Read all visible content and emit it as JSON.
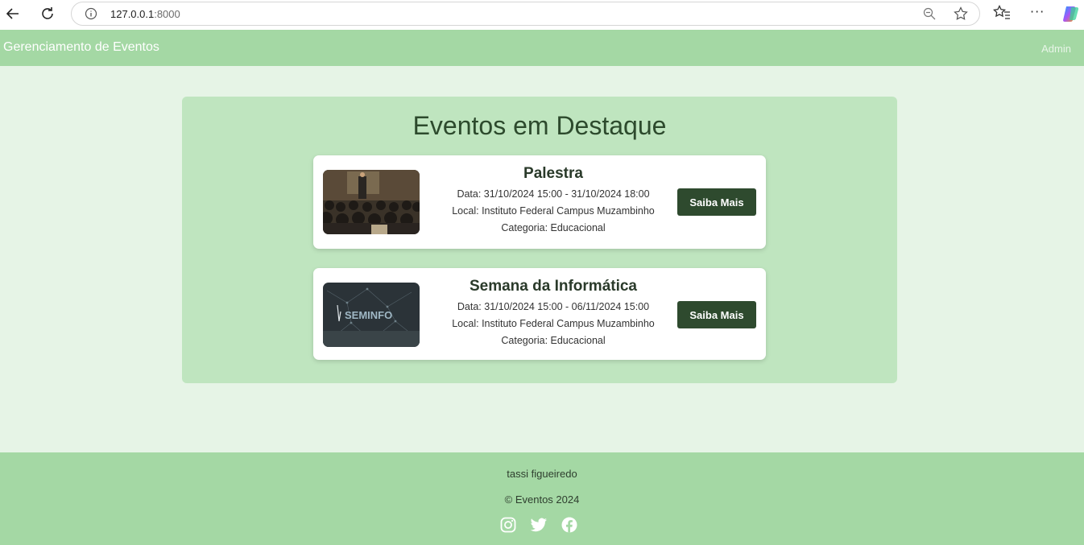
{
  "browser": {
    "url_host": "127.0.0.1",
    "url_port": ":8000"
  },
  "navbar": {
    "brand": "Gerenciamento de Eventos",
    "admin_link": "Admin"
  },
  "featured": {
    "title": "Eventos em Destaque",
    "events": [
      {
        "name": "Palestra",
        "date": "Data: 31/10/2024 15:00 - 31/10/2024 18:00",
        "location": "Local: Instituto Federal Campus Muzambinho",
        "category": "Categoria: Educacional",
        "button": "Saiba Mais",
        "image_icon": "lecture-audience-photo"
      },
      {
        "name": "Semana da Informática",
        "date": "Data: 31/10/2024 15:00 - 06/11/2024 15:00",
        "location": "Local: Instituto Federal Campus Muzambinho",
        "category": "Categoria: Educacional",
        "button": "Saiba Mais",
        "image_icon": "seminfo-banner",
        "image_text": "SEMINFO"
      }
    ]
  },
  "footer": {
    "author": "tassi figueiredo",
    "copyright": "© Eventos 2024",
    "socials": [
      "instagram-icon",
      "twitter-icon",
      "facebook-icon"
    ]
  },
  "colors": {
    "page_bg": "#e6f4e6",
    "nav_bg": "#a4d8a4",
    "panel_bg": "#bfe5bf",
    "button_bg": "#2e4a2e"
  }
}
